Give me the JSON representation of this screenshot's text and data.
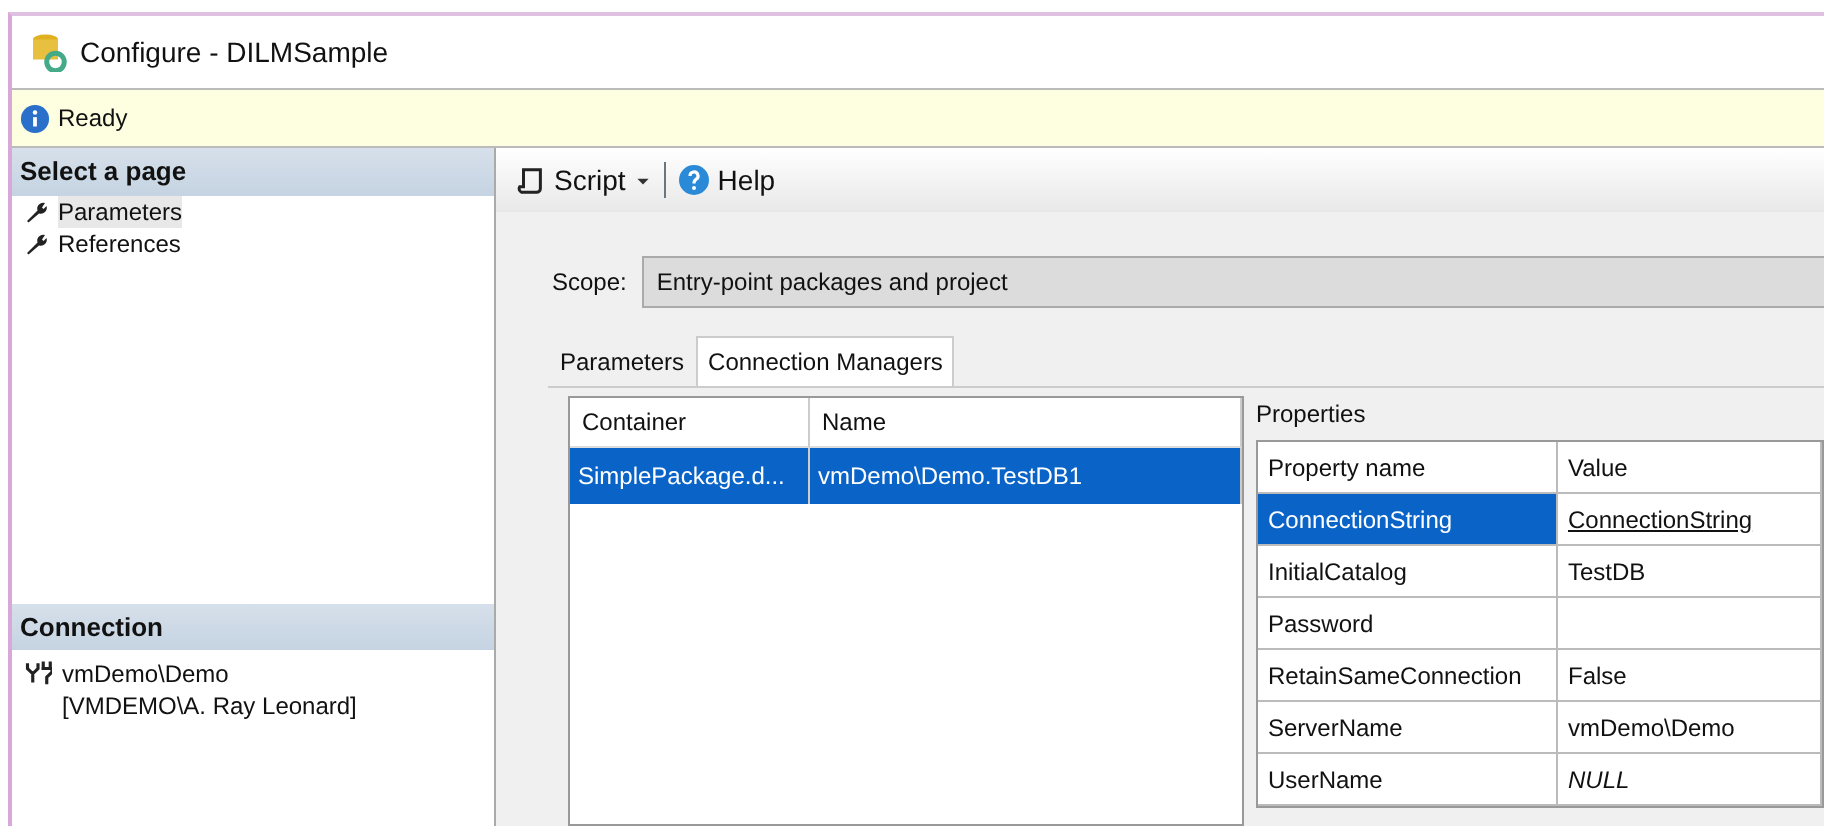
{
  "window": {
    "title": "Configure - DILMSample"
  },
  "status": {
    "text": "Ready"
  },
  "sidebar": {
    "header": "Select a page",
    "items": [
      {
        "label": "Parameters",
        "selected": true
      },
      {
        "label": "References",
        "selected": false
      }
    ]
  },
  "connection": {
    "header": "Connection",
    "text": "vmDemo\\Demo [VMDEMO\\A. Ray Leonard]"
  },
  "toolbar": {
    "script": "Script",
    "help": "Help"
  },
  "scope": {
    "label": "Scope:",
    "value": "Entry-point packages and project"
  },
  "tabs": [
    {
      "label": "Parameters",
      "selected": false
    },
    {
      "label": "Connection Managers",
      "selected": true
    }
  ],
  "managers": {
    "columns": [
      "Container",
      "Name"
    ],
    "rows": [
      {
        "cells": [
          "SimplePackage.d...",
          "vmDemo\\Demo.TestDB1"
        ],
        "selected": true
      }
    ]
  },
  "properties": {
    "title": "Properties",
    "columns": [
      "Property name",
      "Value"
    ],
    "rows": [
      {
        "name": "ConnectionString",
        "value": "ConnectionString",
        "selected": true,
        "link": true,
        "italic": false
      },
      {
        "name": "InitialCatalog",
        "value": "TestDB",
        "selected": false,
        "link": false,
        "italic": false
      },
      {
        "name": "Password",
        "selected": false
      },
      {
        "name": "RetainSameConnection",
        "value": "False",
        "selected": false,
        "link": false,
        "italic": false
      },
      {
        "name": "ServerName",
        "value": "vmDemo\\Demo",
        "selected": false,
        "link": false,
        "italic": false
      },
      {
        "name": "UserName",
        "value": "NULL",
        "selected": false,
        "link": false,
        "italic": true
      }
    ]
  }
}
